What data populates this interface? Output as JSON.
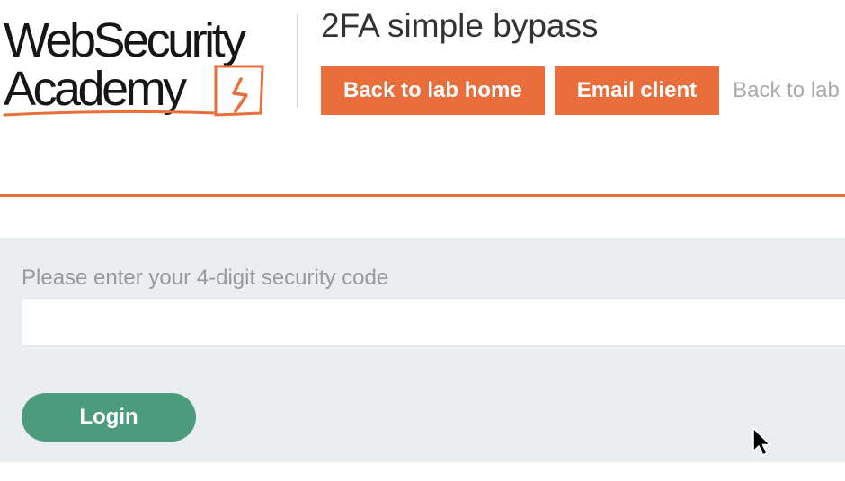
{
  "header": {
    "logo": {
      "line1": "WebSecurity",
      "line2": "Academy"
    },
    "lab_title": "2FA simple bypass",
    "nav": {
      "back_to_lab_home": "Back to lab home",
      "email_client": "Email client",
      "back_to_lab_description": "Back to lab description"
    }
  },
  "form": {
    "security_code_label": "Please enter your 4-digit security code",
    "security_code_value": "",
    "login_label": "Login"
  },
  "colors": {
    "accent": "#e96e3c",
    "login": "#4c9b7d",
    "panel": "#ebeef1"
  },
  "icons": {
    "logo_mark": "lightning-bolt-icon",
    "cursor": "mouse-pointer-icon"
  }
}
